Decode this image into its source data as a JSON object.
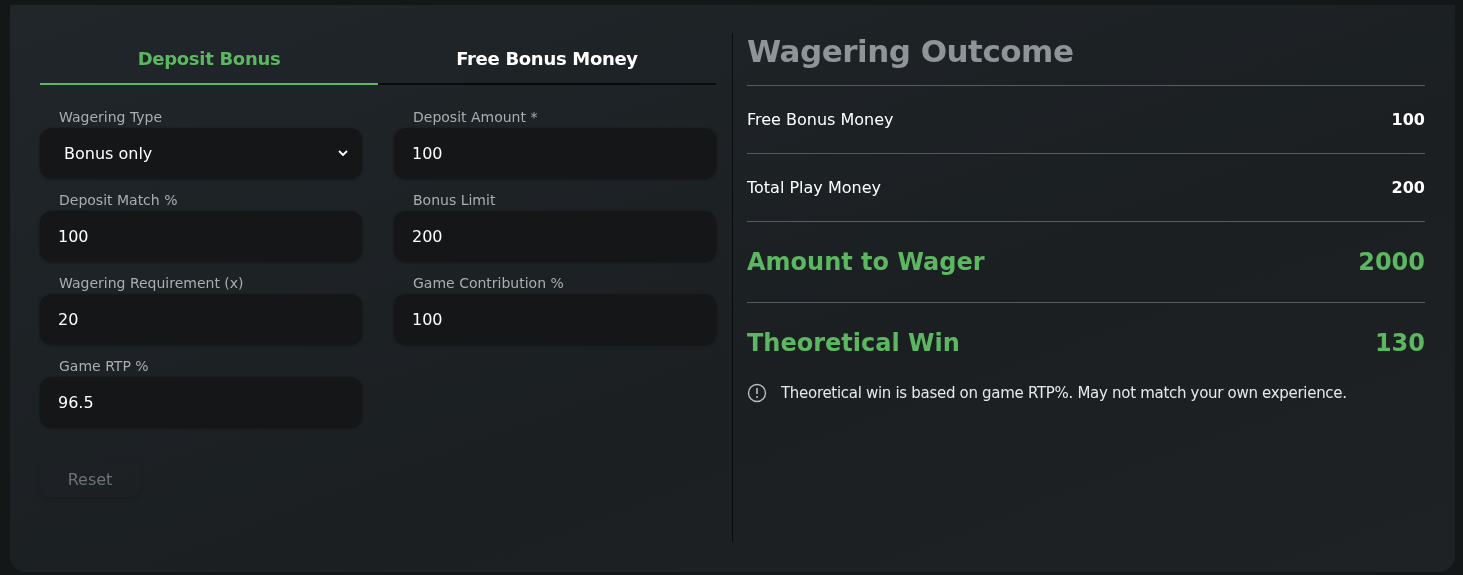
{
  "tabs": [
    {
      "label": "Deposit Bonus",
      "selected": true
    },
    {
      "label": "Free Bonus Money",
      "selected": false
    }
  ],
  "fields": [
    {
      "label": "Wagering Type",
      "kind": "select",
      "value": "Bonus only"
    },
    {
      "label": "Deposit Amount *",
      "kind": "input",
      "value": "100"
    },
    {
      "label": "Deposit Match %",
      "kind": "input",
      "value": "100"
    },
    {
      "label": "Bonus Limit",
      "kind": "input",
      "value": "200"
    },
    {
      "label": "Wagering Requirement (x)",
      "kind": "input",
      "value": "20"
    },
    {
      "label": "Game Contribution %",
      "kind": "input",
      "value": "100"
    },
    {
      "label": "Game RTP %",
      "kind": "input",
      "value": "96.5"
    }
  ],
  "reset_button": {
    "label": "Reset",
    "disabled": true
  },
  "outcome": {
    "title": "Wagering Outcome",
    "rows": [
      {
        "label": "Free Bonus Money",
        "value": "100",
        "kind": "plain"
      },
      {
        "label": "Total Play Money",
        "value": "200",
        "kind": "plain"
      },
      {
        "label": "Amount to Wager",
        "value": "2000",
        "kind": "highlight"
      },
      {
        "label": "Theoretical Win",
        "value": "130",
        "kind": "highlight"
      }
    ],
    "note": "Theoretical win is based on game RTP%. May not match your own experience."
  }
}
